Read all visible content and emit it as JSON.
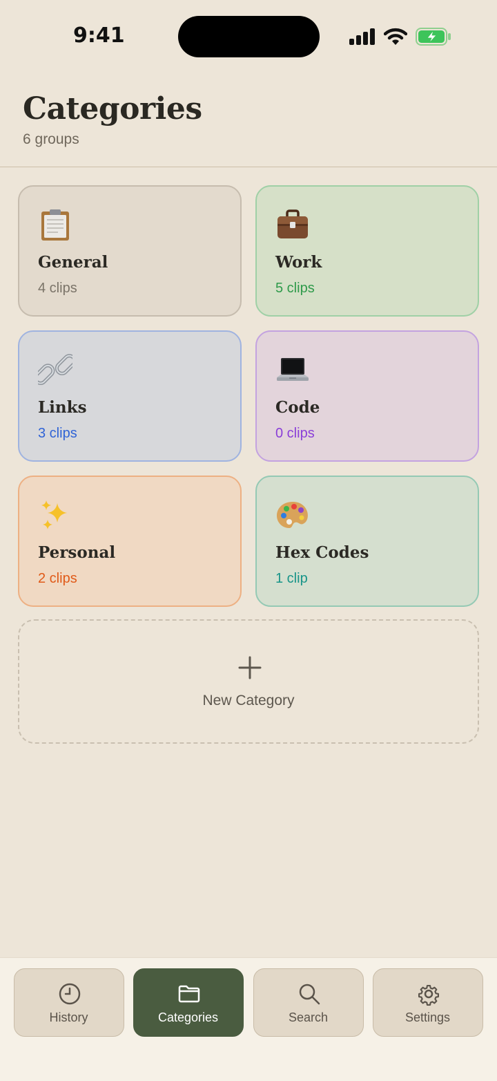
{
  "status_bar": {
    "time": "9:41"
  },
  "header": {
    "title": "Categories",
    "subtitle": "6 groups"
  },
  "categories": [
    {
      "name": "General",
      "count": "4 clips",
      "icon": "clipboard-icon",
      "accent": "#7a7368",
      "bg": "#e3dacd",
      "border": "#c6bcae"
    },
    {
      "name": "Work",
      "count": "5 clips",
      "icon": "briefcase-icon",
      "accent": "#2e9a4a",
      "bg": "#d6e0c8",
      "border": "#9fd0a6"
    },
    {
      "name": "Links",
      "count": "3 clips",
      "icon": "link-icon",
      "accent": "#2f63d6",
      "bg": "#d7d8db",
      "border": "#9fb3e0"
    },
    {
      "name": "Code",
      "count": "0 clips",
      "icon": "laptop-icon",
      "accent": "#8a3ed8",
      "bg": "#e3d4db",
      "border": "#c3a2e0"
    },
    {
      "name": "Personal",
      "count": "2 clips",
      "icon": "sparkles-icon",
      "accent": "#e05a18",
      "bg": "#f0d9c3",
      "border": "#edb083"
    },
    {
      "name": "Hex Codes",
      "count": "1 clip",
      "icon": "palette-icon",
      "accent": "#179488",
      "bg": "#d5dfcf",
      "border": "#94c9b4"
    }
  ],
  "new_category": {
    "label": "New Category"
  },
  "tabs": [
    {
      "label": "History",
      "icon": "clock-icon",
      "active": false
    },
    {
      "label": "Categories",
      "icon": "folder-icon",
      "active": true
    },
    {
      "label": "Search",
      "icon": "search-icon",
      "active": false
    },
    {
      "label": "Settings",
      "icon": "gear-icon",
      "active": false
    }
  ],
  "colors": {
    "background": "#ede5d8",
    "active_tab": "#4a5c40"
  }
}
